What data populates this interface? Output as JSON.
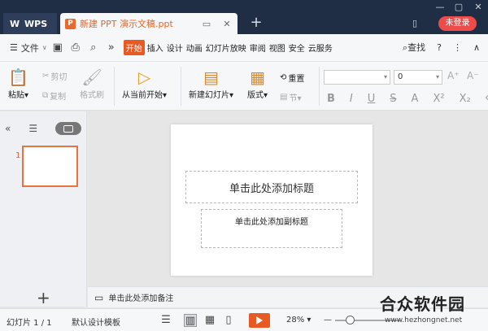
{
  "titlebar": {
    "wps_tab": "WPS",
    "doc_tab_icon": "P",
    "doc_tab_title": "新建 PPT 演示文稿.ppt",
    "new_tab": "+",
    "login": "未登录"
  },
  "menubar": {
    "file": "文件",
    "tabs": [
      "开始",
      "插入",
      "设计",
      "动画",
      "幻灯片放映",
      "审阅",
      "视图",
      "安全",
      "云服务"
    ],
    "active_tab": "开始",
    "search": "查找",
    "help": "?"
  },
  "ribbon": {
    "paste": "粘贴",
    "cut": "剪切",
    "copy": "复制",
    "format_painter": "格式刷",
    "from_current": "从当前开始",
    "new_slide": "新建幻灯片",
    "layout": "版式",
    "reset": "重置",
    "section": "节",
    "font_name": "",
    "font_size": "0"
  },
  "left_panel": {
    "slide_number": "1",
    "add": "+"
  },
  "slide": {
    "title_placeholder": "单击此处添加标题",
    "subtitle_placeholder": "单击此处添加副标题"
  },
  "notes": {
    "placeholder": "单击此处添加备注"
  },
  "statusbar": {
    "slide_indicator": "幻灯片 1 / 1",
    "template": "默认设计模板",
    "zoom": "28%"
  },
  "watermark": {
    "main": "合众软件园",
    "url": "www.hezhongnet.net"
  },
  "colors": {
    "titlebar_bg": "#1f2d45",
    "accent": "#e85a24",
    "login": "#ee4b4b"
  }
}
